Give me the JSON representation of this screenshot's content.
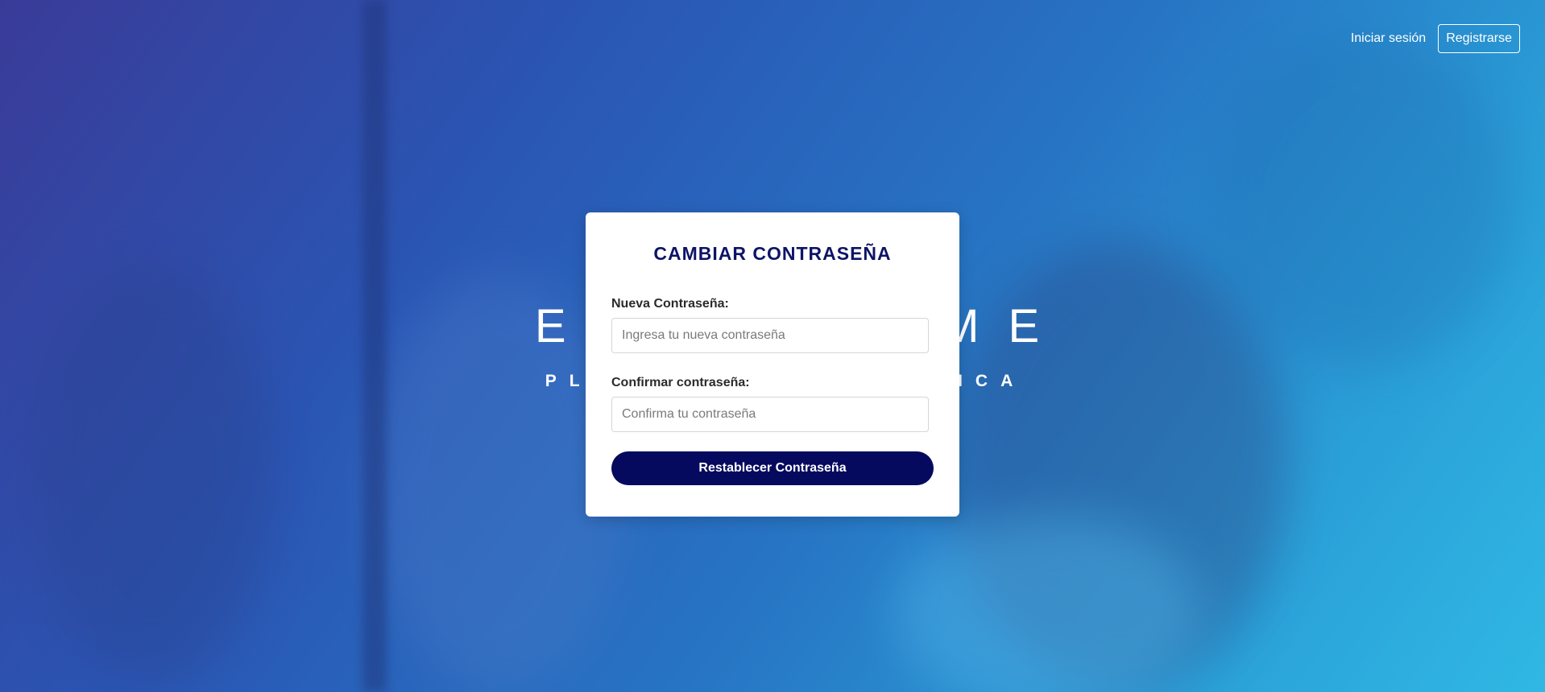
{
  "nav": {
    "login_label": "Iniciar sesión",
    "register_label": "Registrarse"
  },
  "brand": {
    "title": "ESTUDIAME",
    "subtitle": "PLATAFORMA ACADÉMICA"
  },
  "form": {
    "title": "CAMBIAR CONTRASEÑA",
    "new_password_label": "Nueva Contraseña:",
    "new_password_placeholder": "Ingresa tu nueva contraseña",
    "confirm_password_label": "Confirmar contraseña:",
    "confirm_password_placeholder": "Confirma tu contraseña",
    "submit_label": "Restablecer Contraseña"
  },
  "colors": {
    "primary": "#060a5e",
    "title": "#0d1466",
    "gradient_start": "#3a3b98",
    "gradient_end": "#30b8e4"
  }
}
